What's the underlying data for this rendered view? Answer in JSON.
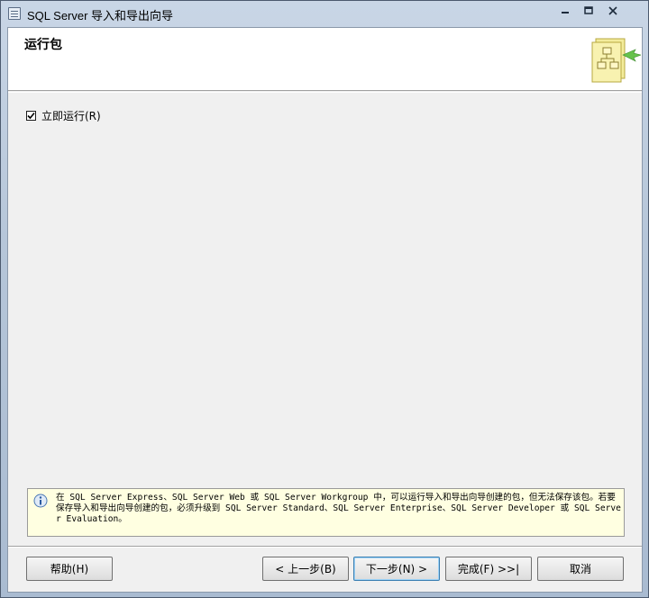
{
  "window": {
    "title": "SQL Server 导入和导出向导",
    "icon": "app-icon",
    "controls": {
      "minimize": "minimize-icon",
      "maximize": "maximize-icon",
      "close": "close-icon"
    }
  },
  "header": {
    "page_title": "运行包",
    "graphic": "wizard-graphic"
  },
  "options": {
    "run_now_label": "立即运行(R)",
    "run_now_checked": true
  },
  "info": {
    "icon": "info-icon",
    "text": "在 SQL Server Express、SQL Server Web 或 SQL Server Workgroup 中，可以运行导入和导出向导创建的包，但无法保存该包。若要保存导入和导出向导创建的包，必须升级到 SQL Server Standard、SQL Server Enterprise、SQL Server Developer 或 SQL Server Evaluation。"
  },
  "buttons": {
    "help": "帮助(H)",
    "back": "< 上一步(B)",
    "next": "下一步(N) >",
    "finish": "完成(F) >>|",
    "cancel": "取消"
  },
  "colors": {
    "info_background": "#ffffe1",
    "dialog_background": "#f0f0f0",
    "header_background": "#ffffff"
  }
}
